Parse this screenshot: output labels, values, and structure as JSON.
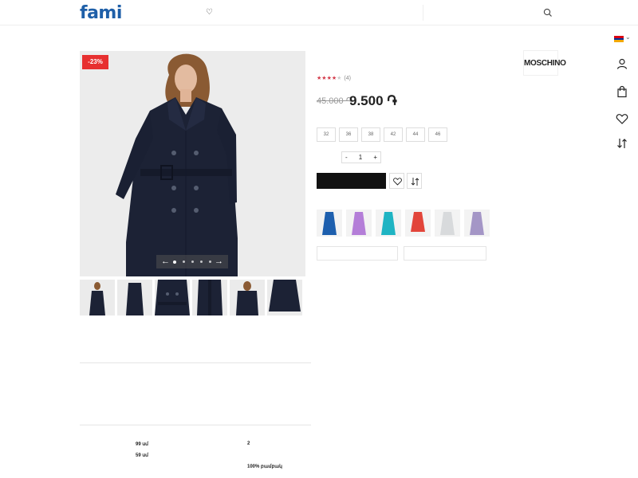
{
  "header": {
    "logo": "fami",
    "nav": [
      "",
      "",
      "",
      "",
      "",
      ""
    ],
    "nav_special": "",
    "search_placeholder": ""
  },
  "breadcrumb": "",
  "gallery": {
    "discount": "-23%",
    "slide_count": 5,
    "active_slide": 1,
    "thumbnail_count": 6
  },
  "product": {
    "title": "",
    "rating": 4,
    "rating_max": 5,
    "review_count": "(4)",
    "sku": "",
    "old_price": "45.000 ֏",
    "new_price": "9.500 ֏",
    "brand": "MOSCHINO"
  },
  "sizes": {
    "label": "",
    "options": [
      "32",
      "36",
      "38",
      "42",
      "44",
      "46"
    ]
  },
  "quantity": {
    "label": "",
    "minus": "-",
    "value": "1",
    "plus": "+"
  },
  "actions": {
    "add_to_cart": ""
  },
  "colors": {
    "label": "",
    "swatches": [
      "#1d5fae",
      "#b47ed8",
      "#1fb4c3",
      "#e2453a",
      "#d8dadc",
      "#a496c6"
    ]
  },
  "tabs": {
    "left": "",
    "right": ""
  },
  "description": {
    "heading": "",
    "text": ""
  },
  "parameters": {
    "heading": "",
    "items": [
      {
        "key": "",
        "value": "99 սմ"
      },
      {
        "key": "",
        "value": "59 սմ"
      },
      {
        "key": "",
        "value": ""
      },
      {
        "key": "",
        "value": "2"
      },
      {
        "key": "",
        "value": ""
      },
      {
        "key": "",
        "value": "100% բամբակ"
      }
    ]
  },
  "colors_theme": {
    "brand_blue": "#1e5fa8",
    "discount_red": "#e73030",
    "star_color": "#d33a4a",
    "coat_navy": "#1c2235"
  },
  "flag": [
    "#d90012",
    "#0033a0",
    "#f2a800"
  ]
}
